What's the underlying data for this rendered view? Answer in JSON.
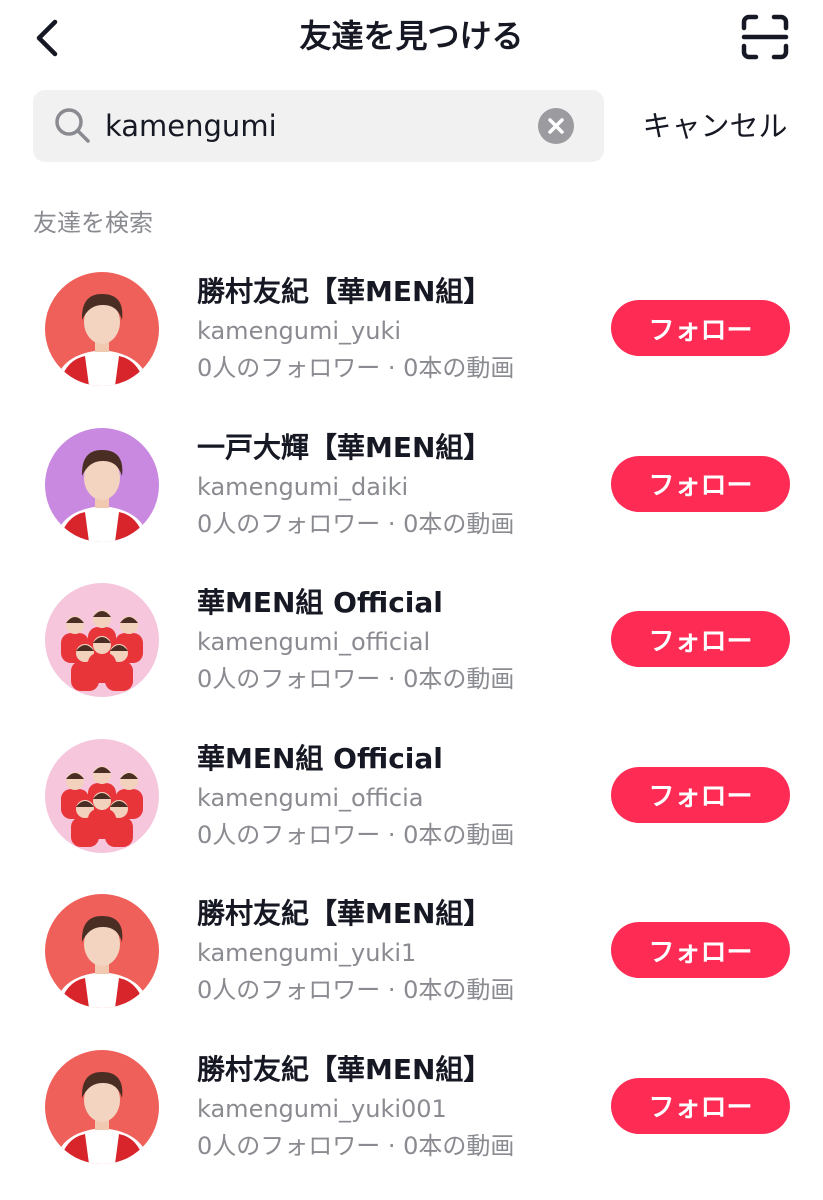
{
  "header": {
    "title": "友達を見つける",
    "back_icon": "chevron-left-icon",
    "scan_icon": "qr-scan-icon"
  },
  "search": {
    "value": "kamengumi",
    "icon": "search-icon",
    "clear_icon": "clear-icon",
    "cancel_label": "キャンセル"
  },
  "section_label": "友達を検索",
  "accent_color": "#fe2c55",
  "results": [
    {
      "name": "勝村友紀【華MEN組】",
      "handle": "kamengumi_yuki",
      "stats": "0人のフォロワー · 0本の動画",
      "follow_label": "フォロー",
      "avatar_type": "single",
      "avatar_bg": "#f0605a"
    },
    {
      "name": "一戸大輝【華MEN組】",
      "handle": "kamengumi_daiki",
      "stats": "0人のフォロワー · 0本の動画",
      "follow_label": "フォロー",
      "avatar_type": "single",
      "avatar_bg": "#c989e0"
    },
    {
      "name": "華MEN組 Official",
      "handle": "kamengumi_official",
      "stats": "0人のフォロワー · 0本の動画",
      "follow_label": "フォロー",
      "avatar_type": "group",
      "avatar_bg": "#f6c6dd"
    },
    {
      "name": "華MEN組 Official",
      "handle": "kamengumi_officia",
      "stats": "0人のフォロワー · 0本の動画",
      "follow_label": "フォロー",
      "avatar_type": "group",
      "avatar_bg": "#f6c6dd"
    },
    {
      "name": "勝村友紀【華MEN組】",
      "handle": "kamengumi_yuki1",
      "stats": "0人のフォロワー · 0本の動画",
      "follow_label": "フォロー",
      "avatar_type": "single",
      "avatar_bg": "#f0605a"
    },
    {
      "name": "勝村友紀【華MEN組】",
      "handle": "kamengumi_yuki001",
      "stats": "0人のフォロワー · 0本の動画",
      "follow_label": "フォロー",
      "avatar_type": "single",
      "avatar_bg": "#f0605a"
    }
  ]
}
